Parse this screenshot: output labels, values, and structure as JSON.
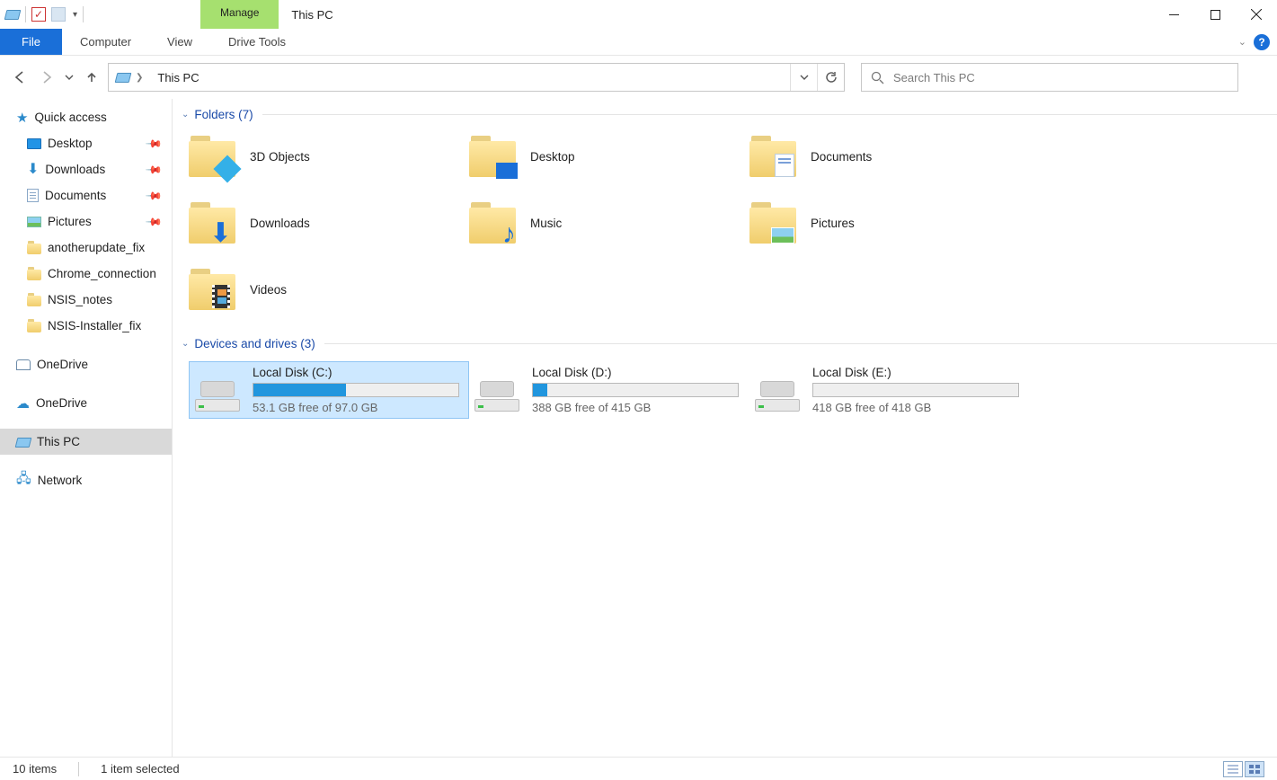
{
  "window": {
    "title": "This PC",
    "context_tab": "Manage"
  },
  "ribbon": {
    "file": "File",
    "computer": "Computer",
    "view": "View",
    "drive_tools": "Drive Tools"
  },
  "address": {
    "location": "This PC"
  },
  "search": {
    "placeholder": "Search This PC"
  },
  "sidebar": {
    "quick_access": "Quick access",
    "quick_items": [
      {
        "label": "Desktop",
        "pinned": true,
        "ico": "monitor"
      },
      {
        "label": "Downloads",
        "pinned": true,
        "ico": "dl"
      },
      {
        "label": "Documents",
        "pinned": true,
        "ico": "doc"
      },
      {
        "label": "Pictures",
        "pinned": true,
        "ico": "pic"
      },
      {
        "label": "anotherupdate_fix",
        "pinned": false,
        "ico": "folder"
      },
      {
        "label": "Chrome_connection",
        "pinned": false,
        "ico": "folder"
      },
      {
        "label": "NSIS_notes",
        "pinned": false,
        "ico": "folder"
      },
      {
        "label": "NSIS-Installer_fix",
        "pinned": false,
        "ico": "folder"
      }
    ],
    "onedrive1": "OneDrive",
    "onedrive2": "OneDrive",
    "this_pc": "This PC",
    "network": "Network"
  },
  "groups": {
    "folders": {
      "label": "Folders",
      "count": 7
    },
    "drives": {
      "label": "Devices and drives",
      "count": 3
    }
  },
  "folders": [
    {
      "name": "3D Objects",
      "ov": "cube"
    },
    {
      "name": "Desktop",
      "ov": "desk"
    },
    {
      "name": "Documents",
      "ov": "doc"
    },
    {
      "name": "Downloads",
      "ov": "dl"
    },
    {
      "name": "Music",
      "ov": "music"
    },
    {
      "name": "Pictures",
      "ov": "pic"
    },
    {
      "name": "Videos",
      "ov": "vid"
    }
  ],
  "drives": [
    {
      "name": "Local Disk (C:)",
      "free": "53.1 GB free of 97.0 GB",
      "fill_pct": 45,
      "selected": true
    },
    {
      "name": "Local Disk (D:)",
      "free": "388 GB free of 415 GB",
      "fill_pct": 7,
      "selected": false
    },
    {
      "name": "Local Disk (E:)",
      "free": "418 GB free of 418 GB",
      "fill_pct": 0,
      "selected": false
    }
  ],
  "status": {
    "items": "10 items",
    "selected": "1 item selected"
  }
}
